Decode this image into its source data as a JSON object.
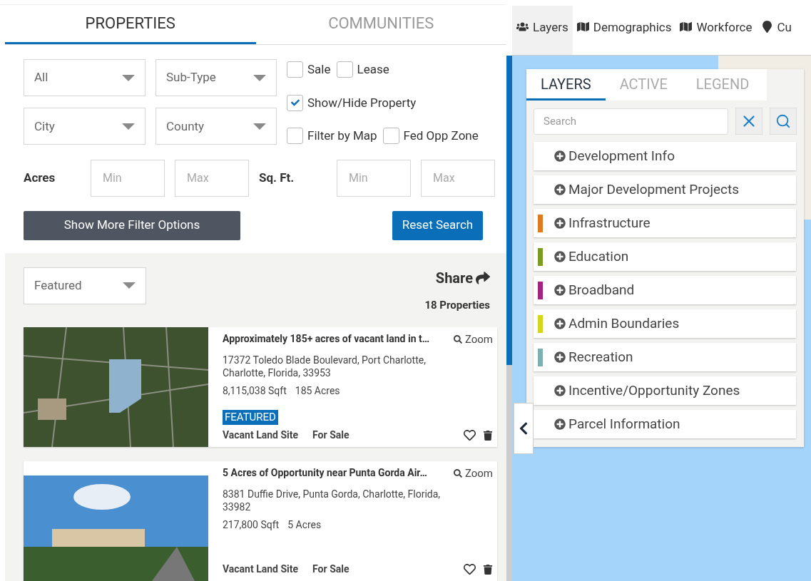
{
  "main_tabs": [
    {
      "label": "PROPERTIES",
      "selected": true
    },
    {
      "label": "COMMUNITIES",
      "selected": false
    }
  ],
  "filters": {
    "selects": [
      {
        "placeholder": "All"
      },
      {
        "placeholder": "Sub-Type"
      },
      {
        "placeholder": "City"
      },
      {
        "placeholder": "County"
      }
    ],
    "checkbox_rows": [
      [
        {
          "label": "Sale",
          "checked": false
        },
        {
          "label": "Lease",
          "checked": false
        }
      ],
      [
        {
          "label": "Show/Hide Property",
          "checked": true
        }
      ],
      [
        {
          "label": "Filter by Map",
          "checked": false
        },
        {
          "label": "Fed Opp Zone",
          "checked": false
        }
      ]
    ],
    "ranges": [
      {
        "label": "Acres",
        "min_placeholder": "Min",
        "max_placeholder": "Max"
      },
      {
        "label": "Sq. Ft.",
        "min_placeholder": "Min",
        "max_placeholder": "Max"
      }
    ],
    "more_button": "Show More Filter Options",
    "reset_button": "Reset Search"
  },
  "results": {
    "sort": "Featured",
    "share": "Share",
    "count": "18 Properties",
    "cards": [
      {
        "title": "Approximately 185+ acres of vacant land in t…",
        "zoom": "Zoom",
        "address": "17372 Toledo Blade Boulevard, Port Charlotte, Charlotte, Florida, 33953",
        "sqft": "8,115,038 Sqft",
        "acres": "185 Acres",
        "badge": "FEATURED",
        "type": "Vacant Land Site",
        "status": "For Sale"
      },
      {
        "title": "5 Acres of Opportunity near Punta Gorda Air…",
        "zoom": "Zoom",
        "address": "8381 Duffie Drive, Punta Gorda, Charlotte, Florida, 33982",
        "sqft": "217,800 Sqft",
        "acres": "5 Acres",
        "type": "Vacant Land Site",
        "status": "For Sale"
      }
    ]
  },
  "map_tabs": [
    {
      "label": "Layers",
      "selected": true
    },
    {
      "label": "Demographics",
      "selected": false
    },
    {
      "label": "Workforce",
      "selected": false
    },
    {
      "label": "Cu",
      "selected": false
    }
  ],
  "layers_panel": {
    "tabs": [
      {
        "label": "LAYERS",
        "selected": true
      },
      {
        "label": "ACTIVE",
        "selected": false
      },
      {
        "label": "LEGEND",
        "selected": false
      }
    ],
    "search": {
      "placeholder": "Search"
    },
    "items": [
      {
        "label": "Development Info"
      },
      {
        "label": "Major Development Projects"
      },
      {
        "label": "Infrastructure",
        "color": "#e07a1f"
      },
      {
        "label": "Education",
        "color": "#7d9a24"
      },
      {
        "label": "Broadband",
        "color": "#a3237f"
      },
      {
        "label": "Admin Boundaries",
        "color": "#d4d61c"
      },
      {
        "label": "Recreation",
        "color": "#7fb0b0"
      },
      {
        "label": "Incentive/Opportunity Zones"
      },
      {
        "label": "Parcel Information"
      }
    ]
  }
}
